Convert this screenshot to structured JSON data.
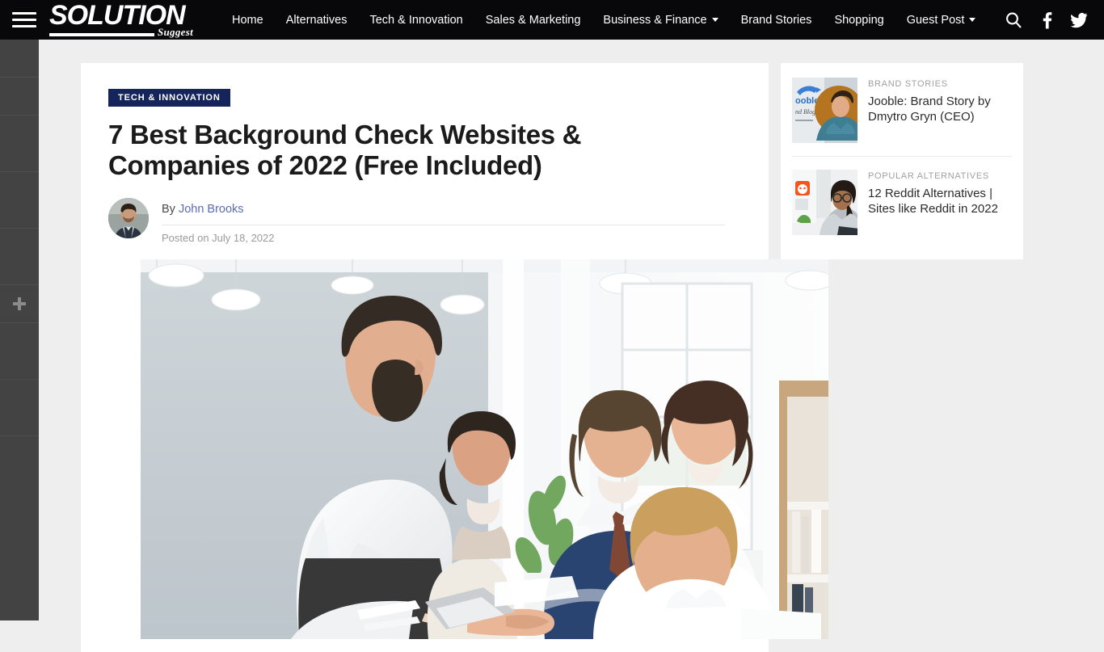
{
  "site": {
    "logo_main": "SOLUTION",
    "logo_sub": "Suggest",
    "menu_icon": "hamburger-icon"
  },
  "nav": {
    "items": [
      {
        "label": "Home",
        "has_dropdown": false
      },
      {
        "label": "Alternatives",
        "has_dropdown": false
      },
      {
        "label": "Tech & Innovation",
        "has_dropdown": false
      },
      {
        "label": "Sales & Marketing",
        "has_dropdown": false
      },
      {
        "label": "Business & Finance",
        "has_dropdown": true
      },
      {
        "label": "Brand Stories",
        "has_dropdown": false
      },
      {
        "label": "Shopping",
        "has_dropdown": false
      },
      {
        "label": "Guest Post",
        "has_dropdown": true
      }
    ],
    "icons": [
      {
        "name": "search-icon"
      },
      {
        "name": "facebook-icon"
      },
      {
        "name": "twitter-icon"
      }
    ]
  },
  "article": {
    "category": "TECH & INNOVATION",
    "category_color": "#15255c",
    "title": "7 Best Background Check Websites & Companies of 2022 (Free Included)",
    "author_prefix": "By",
    "author": "John Brooks",
    "author_link_color": "#5b6bb5",
    "posted": "Posted on July 18, 2022",
    "hero_alt": "Business team shaking hands in a bright office"
  },
  "sidebar": {
    "items": [
      {
        "category": "BRAND STORIES",
        "title": "Jooble: Brand Story by Dmytro Gryn (CEO)",
        "thumb": "jooble-brand-story-thumbnail"
      },
      {
        "category": "POPULAR ALTERNATIVES",
        "title": "12 Reddit Alternatives | Sites like Reddit in 2022",
        "thumb": "reddit-alternatives-thumbnail"
      }
    ]
  },
  "share_rail": {
    "add_icon": "plus-icon"
  },
  "colors": {
    "topbar_bg": "#08080a",
    "page_bg": "#eeeeee",
    "card_bg": "#ffffff",
    "rail_bg": "#434343"
  }
}
